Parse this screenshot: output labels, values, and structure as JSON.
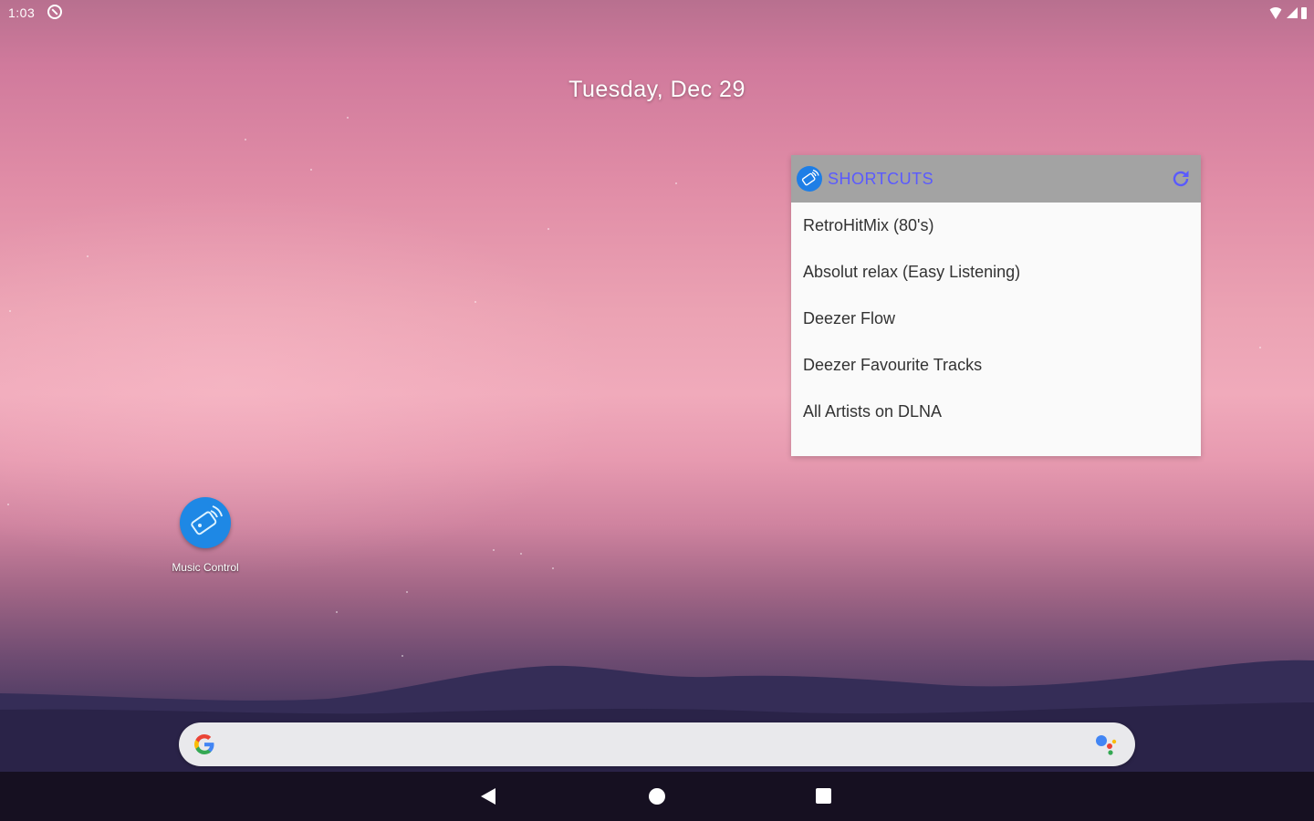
{
  "status_bar": {
    "time": "1:03",
    "notification_icon": "cast-off-icon",
    "icons": [
      "wifi-icon",
      "signal-icon",
      "battery-icon"
    ]
  },
  "home": {
    "date": "Tuesday, Dec 29"
  },
  "widget": {
    "title": "SHORTCUTS",
    "logo_icon": "music-control-logo-icon",
    "refresh_icon": "refresh-icon",
    "accent_color": "#5a5aff",
    "header_color": "#a3a3a3",
    "items": [
      {
        "label": "RetroHitMix (80's)"
      },
      {
        "label": "Absolut relax (Easy Listening)"
      },
      {
        "label": "Deezer Flow"
      },
      {
        "label": "Deezer Favourite Tracks"
      },
      {
        "label": "All Artists on DLNA"
      }
    ]
  },
  "app_icon": {
    "label": "Music Control",
    "icon": "music-control-app-icon",
    "color": "#1e88e5"
  },
  "search_bar": {
    "left_icon": "google-g-icon",
    "right_icon": "google-assistant-icon"
  },
  "nav_bar": {
    "buttons": [
      "back-icon",
      "home-icon",
      "recents-icon"
    ]
  }
}
